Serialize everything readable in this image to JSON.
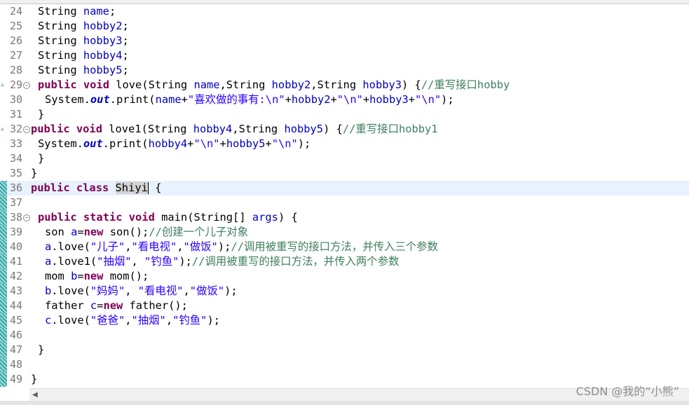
{
  "editor": {
    "watermark": "CSDN @我的“小熊”",
    "lines": [
      {
        "n": "24",
        "t": "String name;"
      },
      {
        "n": "25",
        "t": "String hobby2;"
      },
      {
        "n": "26",
        "t": "String hobby3;"
      },
      {
        "n": "27",
        "t": "String hobby4;"
      },
      {
        "n": "28",
        "t": "String hobby5;"
      },
      {
        "n": "29",
        "t": "public void love(String name,String hobby2,String hobby3) {//重写接口hobby"
      },
      {
        "n": "30",
        "t": "System.out.print(name+\"喜欢做的事有:\\n\"+hobby2+\"\\n\"+hobby3+\"\\n\");"
      },
      {
        "n": "31",
        "t": "}"
      },
      {
        "n": "32",
        "t": "public void love1(String hobby4,String hobby5) {//重写接口hobby1"
      },
      {
        "n": "33",
        "t": "System.out.print(hobby4+\"\\n\"+hobby5+\"\\n\");"
      },
      {
        "n": "34",
        "t": "}"
      },
      {
        "n": "35",
        "t": "}"
      },
      {
        "n": "36",
        "t": "public class Shiyi {"
      },
      {
        "n": "37",
        "t": ""
      },
      {
        "n": "38",
        "t": "public static void main(String[] args) {"
      },
      {
        "n": "39",
        "t": "son a=new son();//创建一个儿子对象"
      },
      {
        "n": "40",
        "t": "a.love(\"儿子\",\"看电视\",\"做饭\");//调用被重写的接口方法，并传入三个参数"
      },
      {
        "n": "41",
        "t": "a.love1(\"抽烟\", \"钓鱼\");//调用被重写的接口方法，并传入两个参数"
      },
      {
        "n": "42",
        "t": "mom b=new mom();"
      },
      {
        "n": "43",
        "t": "b.love(\"妈妈\", \"看电视\",\"做饭\");"
      },
      {
        "n": "44",
        "t": "father c=new father();"
      },
      {
        "n": "45",
        "t": "c.love(\"爸爸\",\"抽烟\",\"钓鱼\");"
      },
      {
        "n": "46",
        "t": ""
      },
      {
        "n": "47",
        "t": "}"
      },
      {
        "n": "48",
        "t": ""
      },
      {
        "n": "49",
        "t": "}"
      }
    ]
  }
}
